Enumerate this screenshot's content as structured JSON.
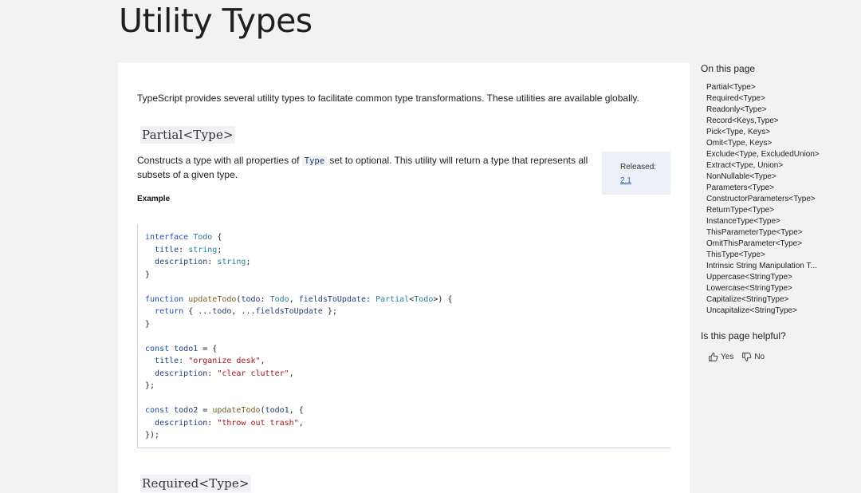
{
  "page": {
    "title": "Utility Types"
  },
  "article": {
    "intro": "TypeScript provides several utility types to facilitate common type transformations. These utilities are available globally.",
    "partial": {
      "heading": "Partial<Type>",
      "desc_before": "Constructs a type with all properties of ",
      "desc_code": "Type",
      "desc_after": " set to optional. This utility will return a type that represents all subsets of a given type.",
      "released_label": "Released:",
      "released_version": "2.1",
      "example_label": "Example"
    },
    "required": {
      "heading": "Required<Type>"
    }
  },
  "toc": {
    "title": "On this page",
    "items": [
      "Partial<Type>",
      "Required<Type>",
      "Readonly<Type>",
      "Record<Keys,Type>",
      "Pick<Type, Keys>",
      "Omit<Type, Keys>",
      "Exclude<Type, ExcludedUnion>",
      "Extract<Type, Union>",
      "NonNullable<Type>",
      "Parameters<Type>",
      "ConstructorParameters<Type>",
      "ReturnType<Type>",
      "InstanceType<Type>",
      "ThisParameterType<Type>",
      "OmitThisParameter<Type>",
      "ThisType<Type>",
      "Intrinsic String Manipulation T...",
      "Uppercase<StringType>",
      "Lowercase<StringType>",
      "Capitalize<StringType>",
      "Uncapitalize<StringType>"
    ]
  },
  "feedback": {
    "question": "Is this page helpful?",
    "yes": "Yes",
    "no": "No"
  }
}
